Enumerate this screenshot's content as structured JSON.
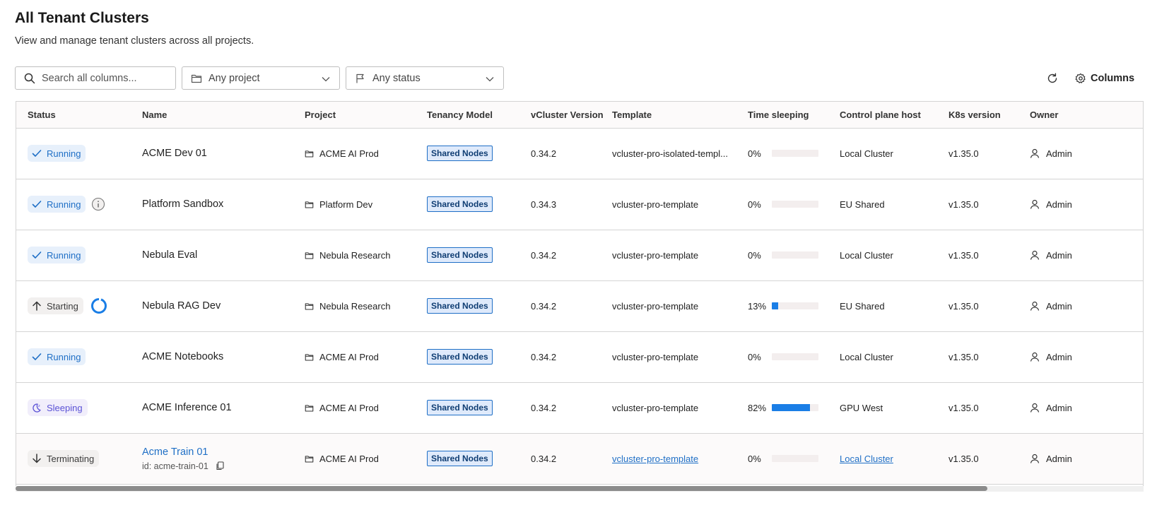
{
  "header": {
    "title": "All Tenant Clusters",
    "subtitle": "View and manage tenant clusters across all projects."
  },
  "toolbar": {
    "search_placeholder": "Search all columns...",
    "project_filter": "Any project",
    "status_filter": "Any status",
    "columns_label": "Columns"
  },
  "table": {
    "columns": [
      "Status",
      "Name",
      "Project",
      "Tenancy Model",
      "vCluster Version",
      "Template",
      "Time sleeping",
      "Control plane host",
      "K8s version",
      "Owner"
    ],
    "rows": [
      {
        "status": "Running",
        "name": "ACME Dev 01",
        "project": "ACME AI Prod",
        "tenancy": "Shared Nodes",
        "version": "0.34.2",
        "template": "vcluster-pro-isolated-templ...",
        "sleep_label": "0%",
        "sleep_value": 0,
        "host": "Local Cluster",
        "k8s": "v1.35.0",
        "owner": "Admin"
      },
      {
        "status": "Running",
        "name": "Platform Sandbox",
        "project": "Platform Dev",
        "tenancy": "Shared Nodes",
        "version": "0.34.3",
        "template": "vcluster-pro-template",
        "sleep_label": "0%",
        "sleep_value": 0,
        "host": "EU Shared",
        "k8s": "v1.35.0",
        "owner": "Admin"
      },
      {
        "status": "Running",
        "name": "Nebula Eval",
        "project": "Nebula Research",
        "tenancy": "Shared Nodes",
        "version": "0.34.2",
        "template": "vcluster-pro-template",
        "sleep_label": "0%",
        "sleep_value": 0,
        "host": "Local Cluster",
        "k8s": "v1.35.0",
        "owner": "Admin"
      },
      {
        "status": "Starting",
        "name": "Nebula RAG Dev",
        "project": "Nebula Research",
        "tenancy": "Shared Nodes",
        "version": "0.34.2",
        "template": "vcluster-pro-template",
        "sleep_label": "13%",
        "sleep_value": 13,
        "host": "EU Shared",
        "k8s": "v1.35.0",
        "owner": "Admin"
      },
      {
        "status": "Running",
        "name": "ACME Notebooks",
        "project": "ACME AI Prod",
        "tenancy": "Shared Nodes",
        "version": "0.34.2",
        "template": "vcluster-pro-template",
        "sleep_label": "0%",
        "sleep_value": 0,
        "host": "Local Cluster",
        "k8s": "v1.35.0",
        "owner": "Admin"
      },
      {
        "status": "Sleeping",
        "name": "ACME Inference 01",
        "project": "ACME AI Prod",
        "tenancy": "Shared Nodes",
        "version": "0.34.2",
        "template": "vcluster-pro-template",
        "sleep_label": "82%",
        "sleep_value": 82,
        "host": "GPU West",
        "k8s": "v1.35.0",
        "owner": "Admin"
      },
      {
        "status": "Terminating",
        "name": "Acme Train 01",
        "id_line": "id: acme-train-01",
        "project": "ACME AI Prod",
        "tenancy": "Shared Nodes",
        "version": "0.34.2",
        "template": "vcluster-pro-template",
        "sleep_label": "0%",
        "sleep_value": 0,
        "host": "Local Cluster",
        "k8s": "v1.35.0",
        "owner": "Admin"
      }
    ]
  },
  "colors": {
    "accent": "#1f6fc6",
    "running": "#1f6fc6",
    "sleeping": "#5b52d6",
    "sleep_bar": "#1a7ee6"
  },
  "icons": {
    "search": "search-icon",
    "project": "folder-icon",
    "status": "flag-icon",
    "refresh": "refresh-icon",
    "columns": "gear-icon",
    "owner": "user-icon",
    "running": "check-icon",
    "starting": "arrow-up-icon",
    "sleeping": "sleep-icon",
    "terminating": "arrow-down-icon",
    "info": "info-icon",
    "copy": "copy-icon"
  }
}
